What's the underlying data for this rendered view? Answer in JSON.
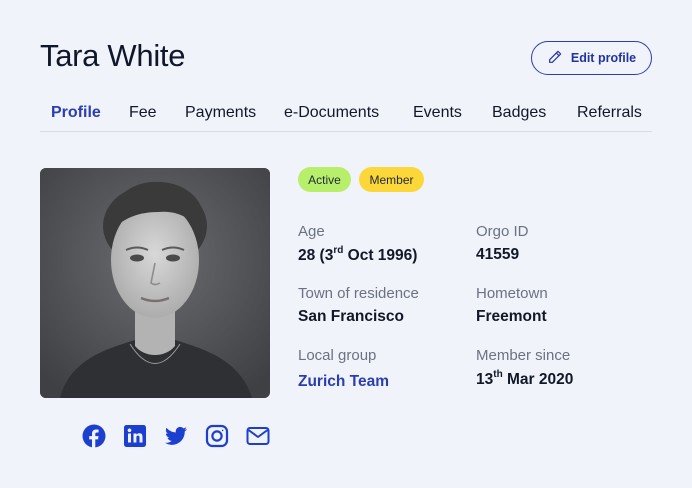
{
  "header": {
    "name": "Tara White",
    "edit_button_label": "Edit profile",
    "edit_icon": "pencil-icon"
  },
  "tabs": [
    {
      "label": "Profile",
      "active": true
    },
    {
      "label": "Fee",
      "active": false
    },
    {
      "label": "Payments",
      "active": false
    },
    {
      "label": "e-Documents",
      "active": false
    },
    {
      "label": "Events",
      "active": false
    },
    {
      "label": "Badges",
      "active": false
    },
    {
      "label": "Referrals",
      "active": false
    }
  ],
  "status_badges": [
    {
      "label": "Active",
      "color": "#b7ef6a"
    },
    {
      "label": "Member",
      "color": "#fcd73a"
    }
  ],
  "fields": {
    "age": {
      "label": "Age",
      "value_prefix": "28 (3",
      "value_sup": "rd",
      "value_suffix": " Oct 1996)"
    },
    "orgo_id": {
      "label": "Orgo ID",
      "value": "41559"
    },
    "town_of_residence": {
      "label": "Town of residence",
      "value": "San Francisco"
    },
    "hometown": {
      "label": "Hometown",
      "value": "Freemont"
    },
    "local_group": {
      "label": "Local group",
      "value": "Zurich Team"
    },
    "member_since": {
      "label": "Member since",
      "value_prefix": "13",
      "value_sup": "th",
      "value_suffix": " Mar 2020"
    }
  },
  "social_icons": [
    "facebook-icon",
    "linkedin-icon",
    "twitter-icon",
    "instagram-icon",
    "email-icon"
  ],
  "colors": {
    "accent": "#2a3eb0",
    "background": "#f1f3fa",
    "social_icon": "#1d3fcf"
  }
}
